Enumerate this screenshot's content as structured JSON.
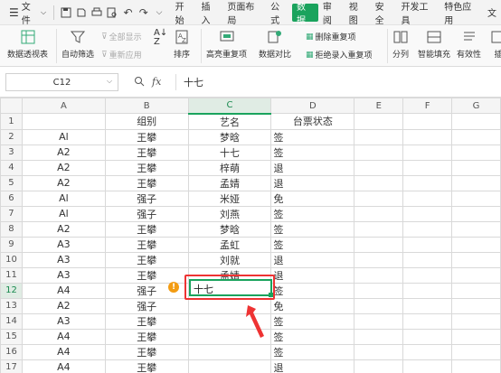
{
  "menubar": {
    "menu_icon": "hamburger-icon",
    "file_label": "文件",
    "tabs": [
      "开始",
      "插入",
      "页面布局",
      "公式",
      "数据",
      "审阅",
      "视图",
      "安全",
      "开发工具",
      "特色应用",
      "文"
    ],
    "active_tab": "数据"
  },
  "ribbon": {
    "pivot": "数据透视表",
    "autofilter": "自动筛选",
    "show_all": "全部显示",
    "reapply": "重新应用",
    "sort": "排序",
    "highlight_dup": "高亮重复项",
    "compare": "数据对比",
    "delete_dup": "删除重复项",
    "reject_dup": "拒绝录入重复项",
    "split": "分列",
    "smart_fill": "智能填充",
    "valid": "有效性",
    "insert": "插"
  },
  "formula_bar": {
    "name_box": "C12",
    "fx": "fx",
    "value": "十七"
  },
  "columns": [
    "A",
    "B",
    "C",
    "D",
    "E",
    "F",
    "G"
  ],
  "rows": [
    {
      "n": "1",
      "a": "",
      "b": "组别",
      "c": "艺名",
      "d": "台票状态"
    },
    {
      "n": "2",
      "a": "Al",
      "b": "王攀",
      "c": "梦晗",
      "d": "签"
    },
    {
      "n": "3",
      "a": "A2",
      "b": "王攀",
      "c": "十七",
      "d": "签"
    },
    {
      "n": "4",
      "a": "A2",
      "b": "王攀",
      "c": "梓萌",
      "d": "退"
    },
    {
      "n": "5",
      "a": "A2",
      "b": "王攀",
      "c": "孟婧",
      "d": "退"
    },
    {
      "n": "6",
      "a": "Al",
      "b": "强子",
      "c": "米娅",
      "d": "免"
    },
    {
      "n": "7",
      "a": "Al",
      "b": "强子",
      "c": "刘燕",
      "d": "签"
    },
    {
      "n": "8",
      "a": "A2",
      "b": "王攀",
      "c": "梦晗",
      "d": "签"
    },
    {
      "n": "9",
      "a": "A3",
      "b": "王攀",
      "c": "孟虹",
      "d": "签"
    },
    {
      "n": "10",
      "a": "A3",
      "b": "王攀",
      "c": "刘就",
      "d": "退"
    },
    {
      "n": "11",
      "a": "A3",
      "b": "王攀",
      "c": "孟婧",
      "d": "退"
    },
    {
      "n": "12",
      "a": "A4",
      "b": "强子",
      "c": "十七",
      "d": "签"
    },
    {
      "n": "13",
      "a": "A2",
      "b": "强子",
      "c": "",
      "d": "免"
    },
    {
      "n": "14",
      "a": "A3",
      "b": "王攀",
      "c": "",
      "d": "签"
    },
    {
      "n": "15",
      "a": "A4",
      "b": "王攀",
      "c": "",
      "d": "签"
    },
    {
      "n": "16",
      "a": "A4",
      "b": "王攀",
      "c": "",
      "d": "签"
    },
    {
      "n": "17",
      "a": "A4",
      "b": "王攀",
      "c": "",
      "d": "退"
    }
  ],
  "active_cell": "C12",
  "warning_icon": "!",
  "accent_color": "#1aa35d",
  "annotation_color": "#e33333"
}
